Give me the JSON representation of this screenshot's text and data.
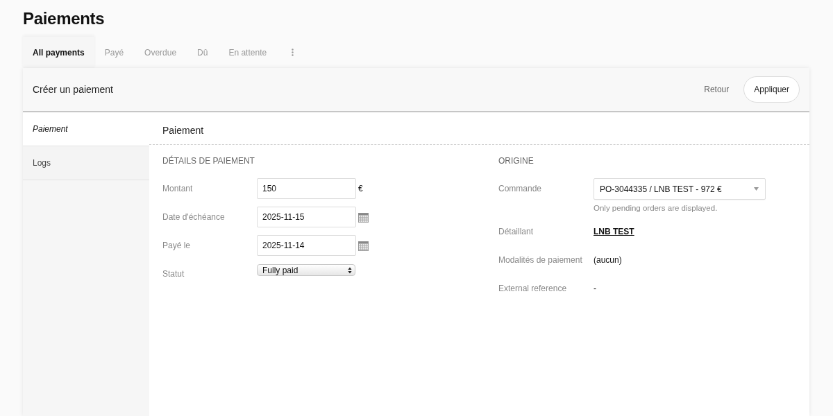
{
  "page": {
    "title": "Paiements"
  },
  "tabs": [
    {
      "label": "All payments",
      "selected": true
    },
    {
      "label": "Payé",
      "selected": false
    },
    {
      "label": "Overdue",
      "selected": false
    },
    {
      "label": "Dû",
      "selected": false
    },
    {
      "label": "En attente",
      "selected": false
    }
  ],
  "panel": {
    "title": "Créer un paiement",
    "buttons": [
      {
        "label": "Retour",
        "kind": "link"
      },
      {
        "label": "Appliquer",
        "kind": "primary"
      }
    ]
  },
  "sidebar": {
    "items": [
      {
        "label": "Paiement",
        "selected": true
      },
      {
        "label": "Logs",
        "selected": false
      }
    ]
  },
  "section": {
    "title": "Paiement"
  },
  "details": {
    "heading": "DÉTAILS DE PAIEMENT",
    "fields": [
      {
        "label": "Montant",
        "kind": "text",
        "value": "150",
        "suffix": "€"
      },
      {
        "label": "Date d'échéance",
        "kind": "date",
        "value": "2025-11-15"
      },
      {
        "label": "Payé le",
        "kind": "date",
        "value": "2025-11-14"
      },
      {
        "label": "Statut",
        "kind": "select",
        "value": "Fully paid"
      }
    ]
  },
  "origin": {
    "heading": "ORIGINE",
    "rows": [
      {
        "label": "Commande",
        "kind": "select",
        "value": "PO-3044335 / LNB TEST - 972 €",
        "help": "Only pending orders are displayed."
      },
      {
        "label": "Détaillant",
        "kind": "link",
        "value": "LNB TEST"
      },
      {
        "label": "Modalités de paiement",
        "kind": "text",
        "value": "(aucun)"
      },
      {
        "label": "External reference",
        "kind": "text",
        "value": "-"
      }
    ]
  }
}
